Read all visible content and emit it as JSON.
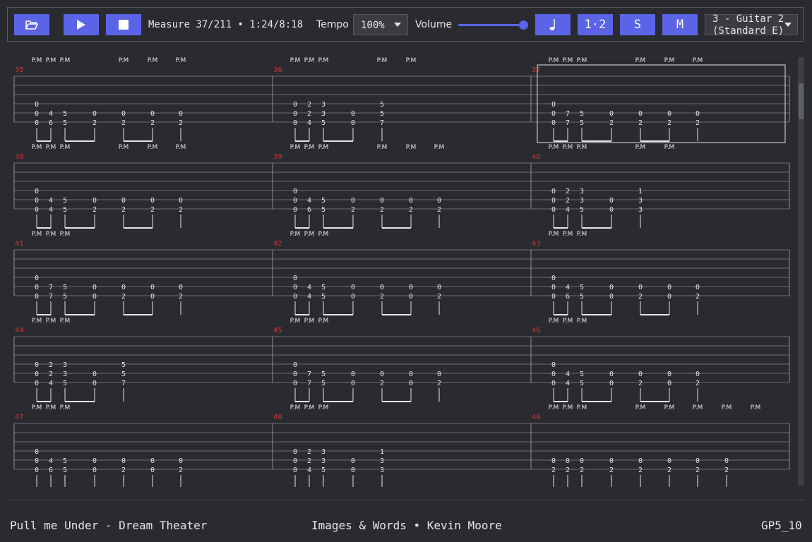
{
  "toolbar": {
    "open_icon": "folder-open-icon",
    "play_icon": "play-icon",
    "stop_icon": "stop-icon",
    "position": "Measure 37/211 • 1:24/8:18",
    "tempo_label": "Tempo",
    "tempo_value": "100%",
    "volume_label": "Volume",
    "volume_level": 1.0,
    "metronome_icon": "quarter-note-icon",
    "count_in_label": "1·2",
    "solo_label": "S",
    "mute_label": "M",
    "track_select": {
      "line1": "3 - Guitar 2",
      "line2": "(Standard E)"
    },
    "accent_color": "#5b63e6"
  },
  "score": {
    "current_measure": 37,
    "rows": [
      {
        "measures": [
          {
            "number": "35",
            "pm": [
              "P.M",
              "P.M",
              "P.M",
              "P.M",
              "P.M",
              "P.M"
            ]
          },
          {
            "number": "36",
            "pm": [
              "P.M",
              "P.M",
              "P.M",
              "P.M",
              "P.M"
            ]
          },
          {
            "number": "37",
            "pm": [
              "P.M",
              "P.M",
              "P.M",
              "P.M",
              "P.M",
              "P.M"
            ]
          }
        ]
      },
      {
        "measures": [
          {
            "number": "38",
            "pm": [
              "P.M",
              "P.M",
              "P.M",
              "P.M",
              "P.M",
              "P.M"
            ]
          },
          {
            "number": "39",
            "pm": [
              "P.M",
              "P.M",
              "P.M",
              "P.M",
              "P.M",
              "P.M"
            ]
          },
          {
            "number": "40",
            "pm": [
              "P.M",
              "P.M",
              "P.M",
              "P.M",
              "P.M"
            ]
          }
        ]
      },
      {
        "measures": [
          {
            "number": "41",
            "pm": [
              "P.M",
              "P.M",
              "P.M"
            ]
          },
          {
            "number": "42",
            "pm": [
              "P.M",
              "P.M",
              "P.M"
            ]
          },
          {
            "number": "43",
            "pm": [
              "P.M",
              "P.M",
              "P.M"
            ]
          }
        ]
      },
      {
        "measures": [
          {
            "number": "44",
            "pm": [
              "P.M",
              "P.M",
              "P.M"
            ]
          },
          {
            "number": "45",
            "pm": [
              "P.M",
              "P.M",
              "P.M"
            ]
          },
          {
            "number": "46",
            "pm": [
              "P.M",
              "P.M",
              "P.M"
            ]
          }
        ]
      },
      {
        "measures": [
          {
            "number": "47",
            "pm": [
              "P.M",
              "P.M",
              "P.M"
            ]
          },
          {
            "number": "48",
            "pm": [
              "P.M",
              "P.M",
              "P.M"
            ]
          },
          {
            "number": "49",
            "pm": [
              "P.M",
              "P.M",
              "P.M",
              "P.M",
              "P.M",
              "P.M",
              "P.M",
              "P.M"
            ]
          }
        ]
      }
    ],
    "frets": {
      "35": [
        [
          "0",
          "0",
          "0"
        ],
        [
          "6",
          "4"
        ],
        [
          "5",
          "5"
        ],
        [
          "2",
          "0"
        ],
        [
          "2",
          "0"
        ],
        [
          "2",
          "0"
        ],
        [
          "2",
          "0"
        ]
      ],
      "36": [
        [
          "0",
          "0",
          "0"
        ],
        [
          "4",
          "2",
          "2"
        ],
        [
          "5",
          "3",
          "3"
        ],
        [
          "0",
          "0"
        ],
        [
          "7",
          "5",
          "5"
        ]
      ],
      "37": [
        [
          "0",
          "0",
          "0"
        ],
        [
          "7",
          "7"
        ],
        [
          "5",
          "5"
        ],
        [
          "2",
          "0"
        ],
        [
          "2",
          "0"
        ],
        [
          "2",
          "0"
        ],
        [
          "2",
          "0"
        ]
      ],
      "38": [
        [
          "0",
          "0",
          "0"
        ],
        [
          "4",
          "4"
        ],
        [
          "5",
          "5"
        ],
        [
          "2",
          "0"
        ],
        [
          "2",
          "0"
        ],
        [
          "2",
          "0"
        ],
        [
          "2",
          "0"
        ]
      ],
      "39": [
        [
          "0",
          "0",
          "0"
        ],
        [
          "6",
          "4"
        ],
        [
          "5",
          "5"
        ],
        [
          "2",
          "0"
        ],
        [
          "2",
          "0"
        ],
        [
          "2",
          "0"
        ],
        [
          "2",
          "0"
        ]
      ],
      "40": [
        [
          "0",
          "0",
          "0"
        ],
        [
          "4",
          "2",
          "2"
        ],
        [
          "5",
          "3",
          "3"
        ],
        [
          "0",
          "0"
        ],
        [
          "3",
          "3",
          "1"
        ]
      ],
      "41": [
        [
          "0",
          "0",
          "0"
        ],
        [
          "7",
          "7"
        ],
        [
          "5",
          "5"
        ],
        [
          "0",
          "0"
        ],
        [
          "2",
          "0"
        ],
        [
          "0",
          "0"
        ],
        [
          "2",
          "0"
        ]
      ],
      "42": [
        [
          "0",
          "0",
          "0"
        ],
        [
          "4",
          "4"
        ],
        [
          "5",
          "5"
        ],
        [
          "0",
          "0"
        ],
        [
          "2",
          "0"
        ],
        [
          "0",
          "0"
        ],
        [
          "2",
          "0"
        ]
      ],
      "43": [
        [
          "0",
          "0",
          "0"
        ],
        [
          "6",
          "4"
        ],
        [
          "5",
          "5"
        ],
        [
          "0",
          "0"
        ],
        [
          "2",
          "0"
        ],
        [
          "0",
          "0"
        ],
        [
          "2",
          "0"
        ]
      ],
      "44": [
        [
          "0",
          "0",
          "0"
        ],
        [
          "4",
          "2",
          "2"
        ],
        [
          "5",
          "3",
          "3"
        ],
        [
          "0",
          "0"
        ],
        [
          "7",
          "5",
          "5"
        ]
      ],
      "45": [
        [
          "0",
          "0",
          "0"
        ],
        [
          "7",
          "7"
        ],
        [
          "5",
          "5"
        ],
        [
          "0",
          "0"
        ],
        [
          "2",
          "0"
        ],
        [
          "0",
          "0"
        ],
        [
          "2",
          "0"
        ]
      ],
      "46": [
        [
          "0",
          "0",
          "0"
        ],
        [
          "4",
          "4"
        ],
        [
          "5",
          "5"
        ],
        [
          "0",
          "0"
        ],
        [
          "2",
          "0"
        ],
        [
          "0",
          "0"
        ],
        [
          "2",
          "0"
        ]
      ],
      "47": [
        [
          "0",
          "0",
          "0"
        ],
        [
          "6",
          "4"
        ],
        [
          "5",
          "5"
        ],
        [
          "0",
          "0"
        ],
        [
          "2",
          "0"
        ],
        [
          "0",
          "0"
        ],
        [
          "2",
          "0"
        ]
      ],
      "48": [
        [
          "0",
          "0",
          "0"
        ],
        [
          "4",
          "2",
          "2"
        ],
        [
          "5",
          "3",
          "3"
        ],
        [
          "0",
          "0"
        ],
        [
          "3",
          "3",
          "1"
        ]
      ],
      "49": [
        [
          "2",
          "0"
        ],
        [
          "2",
          "0"
        ],
        [
          "2",
          "0"
        ],
        [
          "2",
          "0"
        ],
        [
          "2",
          "0"
        ],
        [
          "2",
          "0"
        ],
        [
          "2",
          "0"
        ],
        [
          "2",
          "0"
        ]
      ]
    }
  },
  "footer": {
    "song": "Pull me Under - Dream Theater",
    "album_artist": "Images & Words • Kevin Moore",
    "format": "GP5_10"
  }
}
